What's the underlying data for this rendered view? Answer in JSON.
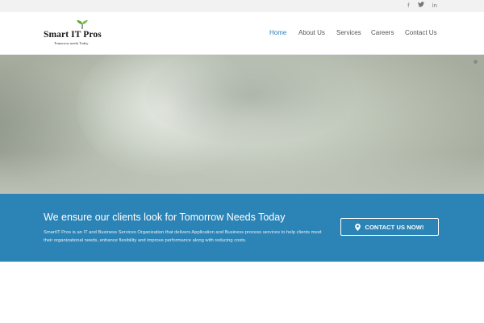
{
  "social": [
    {
      "name": "facebook",
      "glyph": "f"
    },
    {
      "name": "twitter",
      "glyph": "🐦"
    },
    {
      "name": "linkedin",
      "glyph": "in"
    }
  ],
  "logo": {
    "name": "Smart IT Pros",
    "tagline": "Tomorrow needs Today"
  },
  "nav": {
    "items": [
      "Home",
      "About Us",
      "Services",
      "Careers",
      "Contact Us"
    ],
    "active": "Home"
  },
  "hero": {
    "slide_icon": "slider-dot"
  },
  "cta": {
    "heading": "We ensure our clients look for Tomorrow Needs Today",
    "body": "SmartIT Pros is an IT and Business Services Organization that delivers Application and Business process services to help clients meet their organizational needs, enhance flexibility and improve performance along with reducing costs.",
    "button_label": "CONTACT US NOW!",
    "button_icon": "map-marker-icon"
  },
  "colors": {
    "accent": "#2a7fb5",
    "cta_background": "#2c84b6",
    "topbar": "#f2f2f2"
  }
}
